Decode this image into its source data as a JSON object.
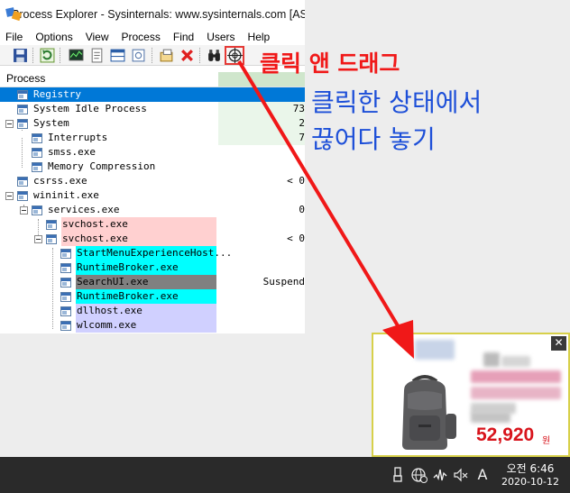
{
  "window": {
    "title": "Process Explorer - Sysinternals: www.sysinternals.com [AS"
  },
  "menu": [
    "File",
    "Options",
    "View",
    "Process",
    "Find",
    "Users",
    "Help"
  ],
  "toolbar": {
    "icons": [
      "save-icon",
      "refresh-icon",
      "system-info-icon",
      "properties-icon",
      "lower-pane-icon",
      "dll-view-icon",
      "handle-view-icon",
      "kill-process-icon",
      "find-icon",
      "find-window-target-icon"
    ]
  },
  "table": {
    "header": "Process",
    "rows": [
      {
        "name": "Registry",
        "value": ""
      },
      {
        "name": "System Idle Process",
        "value": "73"
      },
      {
        "name": "System",
        "value": "2"
      },
      {
        "name": "Interrupts",
        "value": "7"
      },
      {
        "name": "smss.exe",
        "value": ""
      },
      {
        "name": "Memory Compression",
        "value": ""
      },
      {
        "name": "csrss.exe",
        "value": "< 0"
      },
      {
        "name": "wininit.exe",
        "value": ""
      },
      {
        "name": "services.exe",
        "value": "0"
      },
      {
        "name": "svchost.exe",
        "value": ""
      },
      {
        "name": "svchost.exe",
        "value": "< 0"
      },
      {
        "name": "StartMenuExperienceHost...",
        "value": ""
      },
      {
        "name": "RuntimeBroker.exe",
        "value": ""
      },
      {
        "name": "SearchUI.exe",
        "value": "Suspend"
      },
      {
        "name": "RuntimeBroker.exe",
        "value": ""
      },
      {
        "name": "dllhost.exe",
        "value": ""
      },
      {
        "name": "wlcomm.exe",
        "value": ""
      }
    ]
  },
  "annotations": {
    "drag_text": "클릭 앤 드래그",
    "release_line1": "클릭한 상태에서",
    "release_line2": "끊어다 놓기"
  },
  "ad": {
    "price": "52,920",
    "currency": "원",
    "close_symbol": "✕"
  },
  "taskbar": {
    "ime_indicator": "A",
    "time": "오전 6:46",
    "date": "2020-10-12"
  },
  "colors": {
    "selected_row": "#0078d7",
    "service_pink": "#ffd0d0",
    "immersive_cyan": "#00ffff",
    "suspended_gray": "#808080",
    "own_process_lavender": "#d0d0ff",
    "annotation_red": "#f01818",
    "annotation_blue": "#1d4fd8",
    "price_red": "#d8141c"
  }
}
